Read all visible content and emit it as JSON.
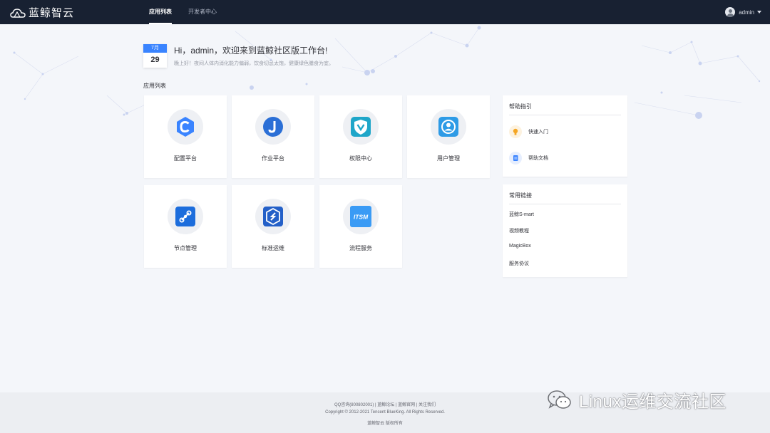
{
  "brand": {
    "name": "蓝鲸智云"
  },
  "nav": {
    "tabs": [
      {
        "label": "应用列表"
      },
      {
        "label": "开发者中心"
      }
    ]
  },
  "user": {
    "name": "admin"
  },
  "greeting": {
    "month": "7月",
    "day": "29",
    "title": "Hi，admin，欢迎来到蓝鲸社区版工作台!",
    "subtitle": "晚上好！夜间人体内消化能力偏弱，饮食切忌太饱，健康绿色膳食为宜。"
  },
  "apps": {
    "section_title": "应用列表",
    "items": [
      {
        "label": "配置平台",
        "icon": "config-platform-icon"
      },
      {
        "label": "作业平台",
        "icon": "job-platform-icon"
      },
      {
        "label": "权限中心",
        "icon": "permission-center-icon"
      },
      {
        "label": "用户管理",
        "icon": "user-management-icon"
      },
      {
        "label": "节点管理",
        "icon": "node-management-icon"
      },
      {
        "label": "标准运维",
        "icon": "standard-ops-icon"
      },
      {
        "label": "流程服务",
        "icon": "itsm-icon",
        "icon_text": "ITSM"
      }
    ]
  },
  "help": {
    "title": "帮助指引",
    "items": [
      {
        "label": "快速入门",
        "icon": "lightbulb-icon"
      },
      {
        "label": "帮助文档",
        "icon": "document-icon"
      }
    ]
  },
  "links": {
    "title": "常用链接",
    "items": [
      "蓝鲸S-mart",
      "视频教程",
      "MagicBox",
      "服务协议"
    ]
  },
  "footer": {
    "links": "QQ咨询(800802001)  |  蓝鲸论坛  |  蓝鲸官网  |  关注我们",
    "copyright": "Copyright © 2012-2021 Tencent BlueKing. All Rights Reserved.",
    "owner": "蓝鲸智云 版权所有"
  },
  "watermark": {
    "text": "Linux运维交流社区"
  },
  "colors": {
    "topbar": "#182132",
    "accent": "#3a84ff",
    "page_bg": "#f4f6fa"
  }
}
